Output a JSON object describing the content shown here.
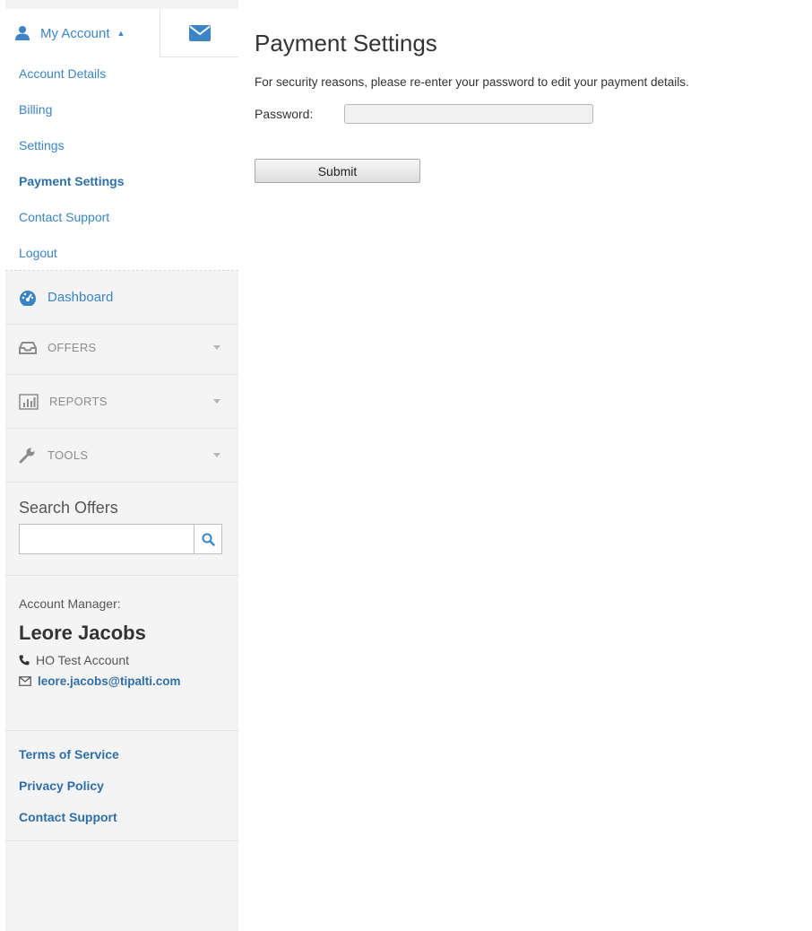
{
  "sidebar": {
    "account_tab": {
      "label": "My Account"
    },
    "account_menu": [
      {
        "label": "Account Details",
        "active": false
      },
      {
        "label": "Billing",
        "active": false
      },
      {
        "label": "Settings",
        "active": false
      },
      {
        "label": "Payment Settings",
        "active": true
      },
      {
        "label": "Contact Support",
        "active": false
      },
      {
        "label": "Logout",
        "active": false
      }
    ],
    "nav": {
      "dashboard": "Dashboard",
      "offers": "OFFERS",
      "reports": "REPORTS",
      "tools": "TOOLS"
    },
    "search": {
      "title": "Search Offers",
      "value": "",
      "placeholder": ""
    },
    "manager": {
      "label": "Account Manager:",
      "name": "Leore Jacobs",
      "phone": "HO Test Account",
      "email": "leore.jacobs@tipalti.com"
    },
    "footer_links": [
      {
        "label": "Terms of Service"
      },
      {
        "label": "Privacy Policy"
      },
      {
        "label": "Contact Support"
      }
    ]
  },
  "main": {
    "title": "Payment Settings",
    "notice": "For security reasons, please re-enter your password to edit your payment details.",
    "password_label": "Password:",
    "password_value": "",
    "submit_label": "Submit"
  },
  "colors": {
    "accent": "#3b84c5",
    "link_bold": "#2e6fa9",
    "sidebar_bg": "#f4f4f4"
  }
}
